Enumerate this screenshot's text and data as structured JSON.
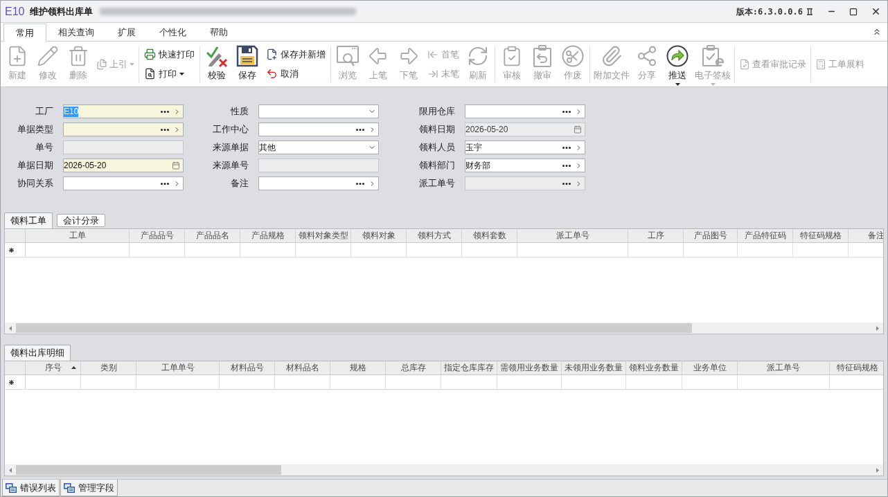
{
  "window": {
    "logo": "E10",
    "title": "维护领料出库单",
    "version": "版本:6.3.0.0.6"
  },
  "ribbon_tabs": [
    {
      "label": "常用",
      "selected": true
    },
    {
      "label": "相关查询",
      "selected": false
    },
    {
      "label": "扩展",
      "selected": false
    },
    {
      "label": "个性化",
      "selected": false
    },
    {
      "label": "帮助",
      "selected": false
    }
  ],
  "toolbar_groups": [
    {
      "items": [
        {
          "label": "新建",
          "kind": "large",
          "disabled": true,
          "menu": false
        },
        {
          "label": "修改",
          "kind": "large",
          "disabled": true,
          "menu": false
        },
        {
          "label": "删除",
          "kind": "large",
          "disabled": true,
          "menu": false
        },
        {
          "label": "上引",
          "kind": "inline",
          "disabled": true,
          "menu": true
        }
      ]
    },
    {
      "items": [
        {
          "label": "快速打印",
          "kind": "small",
          "disabled": false,
          "menu": false
        },
        {
          "label": "打印",
          "kind": "small",
          "disabled": false,
          "menu": true
        }
      ]
    },
    {
      "items": [
        {
          "label": "校验",
          "kind": "large",
          "disabled": false,
          "menu": false
        },
        {
          "label": "保存",
          "kind": "large",
          "disabled": false,
          "menu": false
        },
        {
          "label": "保存并新增",
          "kind": "small",
          "disabled": false,
          "menu": false
        },
        {
          "label": "取消",
          "kind": "small",
          "disabled": false,
          "menu": false
        }
      ]
    },
    {
      "items": [
        {
          "label": "浏览",
          "kind": "large",
          "disabled": true,
          "menu": false
        },
        {
          "label": "上笔",
          "kind": "large",
          "disabled": true,
          "menu": false
        },
        {
          "label": "下笔",
          "kind": "large",
          "disabled": true,
          "menu": false
        },
        {
          "label": "首笔",
          "kind": "small",
          "disabled": true,
          "menu": false
        },
        {
          "label": "末笔",
          "kind": "small",
          "disabled": true,
          "menu": false
        },
        {
          "label": "刷新",
          "kind": "large",
          "disabled": true,
          "menu": false
        }
      ]
    },
    {
      "items": [
        {
          "label": "审核",
          "kind": "large",
          "disabled": true,
          "menu": false
        },
        {
          "label": "撤审",
          "kind": "large",
          "disabled": true,
          "menu": false
        },
        {
          "label": "作废",
          "kind": "large",
          "disabled": true,
          "menu": false
        }
      ]
    },
    {
      "items": [
        {
          "label": "附加文件",
          "kind": "large",
          "disabled": true,
          "menu": false
        },
        {
          "label": "分享",
          "kind": "large",
          "disabled": true,
          "menu": false
        },
        {
          "label": "推送",
          "kind": "large",
          "disabled": false,
          "menu": true
        },
        {
          "label": "电子签核",
          "kind": "large",
          "disabled": true,
          "menu": true
        }
      ]
    },
    {
      "items": [
        {
          "label": "查看审批记录",
          "kind": "inline",
          "disabled": true,
          "menu": false
        }
      ]
    },
    {
      "items": [
        {
          "label": "工单展料",
          "kind": "inline",
          "disabled": true,
          "menu": false
        }
      ]
    }
  ],
  "form": {
    "fields": [
      {
        "label": "工厂",
        "kind": "lookup",
        "value": "E10",
        "required": true,
        "disabled": false,
        "highlighted": true
      },
      {
        "label": "性质",
        "kind": "dropdown",
        "required": false,
        "disabled": false
      },
      {
        "label": "限用仓库",
        "kind": "lookup",
        "required": false,
        "disabled": false
      },
      {
        "label": "单据类型",
        "kind": "lookup",
        "required": true,
        "disabled": false
      },
      {
        "label": "工作中心",
        "kind": "lookup",
        "required": false,
        "disabled": false
      },
      {
        "label": "领料日期",
        "kind": "date",
        "value": "2026-05-20",
        "required": false,
        "disabled": true,
        "highlighted": false
      },
      {
        "label": "单号",
        "kind": "text",
        "required": false,
        "disabled": true
      },
      {
        "label": "来源单据",
        "kind": "dropdown",
        "value": "其他",
        "required": false,
        "disabled": false,
        "highlighted": false
      },
      {
        "label": "领料人员",
        "kind": "lookup",
        "value": "玉宇",
        "required": false,
        "disabled": false,
        "highlighted": false
      },
      {
        "label": "单据日期",
        "kind": "date",
        "value": "2026-05-20",
        "required": true,
        "disabled": false,
        "highlighted": false
      },
      {
        "label": "来源单号",
        "kind": "text",
        "required": false,
        "disabled": true
      },
      {
        "label": "领料部门",
        "kind": "lookup",
        "value": "财务部",
        "required": false,
        "disabled": false,
        "highlighted": false
      },
      {
        "label": "协同关系",
        "kind": "lookup",
        "required": false,
        "disabled": false
      },
      {
        "label": "备注",
        "kind": "lookup",
        "required": false,
        "disabled": false
      },
      {
        "label": "派工单号",
        "kind": "lookup",
        "required": false,
        "disabled": true
      }
    ]
  },
  "grids": [
    {
      "tabs": [
        {
          "label": "领料工单",
          "selected": true
        },
        {
          "label": "会计分录",
          "selected": false
        }
      ],
      "new_row": true,
      "columns": [
        {
          "label": "工单"
        },
        {
          "label": "产品品号"
        },
        {
          "label": "产品品名"
        },
        {
          "label": "产品规格"
        },
        {
          "label": "领料对象类型"
        },
        {
          "label": "领料对象"
        },
        {
          "label": "领料方式"
        },
        {
          "label": "领料套数"
        },
        {
          "label": "派工单号"
        },
        {
          "label": "工序"
        },
        {
          "label": "产品图号"
        },
        {
          "label": "产品特征码"
        },
        {
          "label": "特征码规格"
        },
        {
          "label": "备注"
        }
      ]
    },
    {
      "tabs": [
        {
          "label": "领料出库明细",
          "selected": true
        }
      ],
      "new_row": true,
      "columns": [
        {
          "label": "序号",
          "sorted": true
        },
        {
          "label": "类别",
          "sorted": false
        },
        {
          "label": "工单单号",
          "sorted": false
        },
        {
          "label": "材料品号",
          "sorted": false
        },
        {
          "label": "材料品名",
          "sorted": false
        },
        {
          "label": "规格",
          "sorted": false
        },
        {
          "label": "总库存",
          "sorted": false
        },
        {
          "label": "指定仓库库存",
          "sorted": false
        },
        {
          "label": "需领用业务数量",
          "sorted": false
        },
        {
          "label": "未领用业务数量",
          "sorted": false
        },
        {
          "label": "领料业务数量",
          "sorted": false
        },
        {
          "label": "业务单位",
          "sorted": false
        },
        {
          "label": "派工单号",
          "sorted": false
        },
        {
          "label": "特征码规格",
          "sorted": false
        }
      ]
    }
  ],
  "bottom_tabs": [
    {
      "label": "错误列表"
    },
    {
      "label": "管理字段"
    }
  ]
}
